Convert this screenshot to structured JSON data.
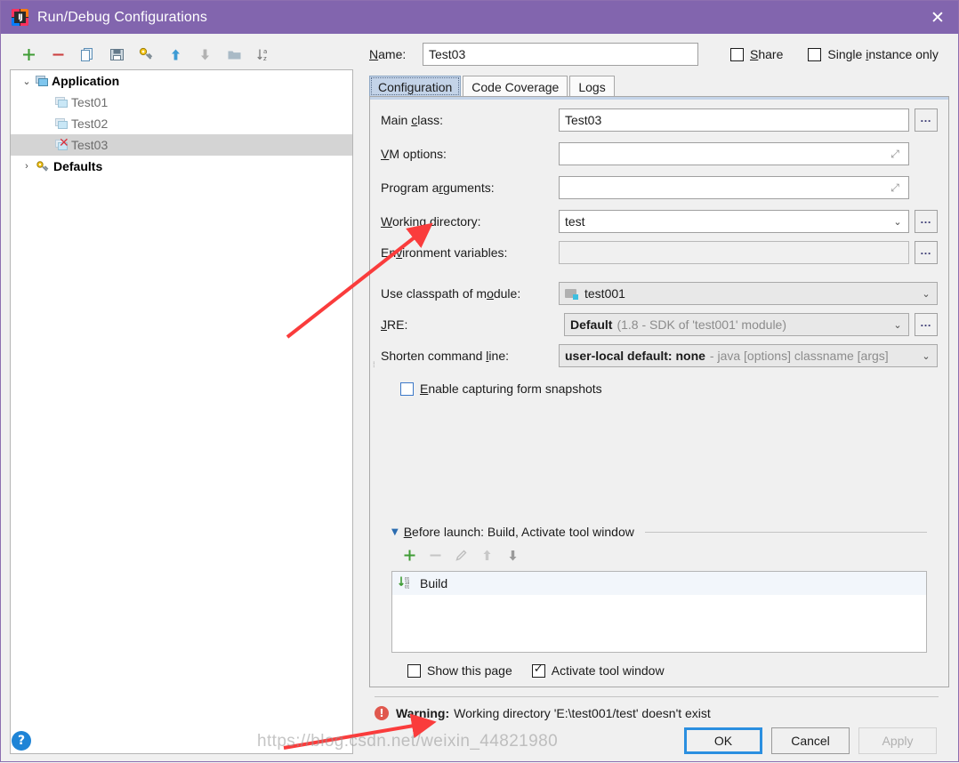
{
  "window": {
    "title": "Run/Debug Configurations",
    "logo_icon": "intellij-idea-logo",
    "close_icon": "close-icon",
    "titlebar_color": "#8265ae"
  },
  "toolbar": {
    "buttons": [
      {
        "name": "add",
        "icon": "plus-icon",
        "color": "#3f9c35"
      },
      {
        "name": "remove",
        "icon": "minus-icon",
        "color": "#cc4141"
      },
      {
        "name": "copy",
        "icon": "copy-icon",
        "color": "#6ca6cf"
      },
      {
        "name": "save",
        "icon": "save-icon",
        "color": "#6f8fa8"
      },
      {
        "name": "edit-templates",
        "icon": "wrench-icon",
        "color": "#d9a404"
      },
      {
        "name": "move-up",
        "icon": "arrow-up-icon",
        "color": "#3d9bd4"
      },
      {
        "name": "move-down",
        "icon": "arrow-down-icon",
        "color": "#a8a8a8"
      },
      {
        "name": "folder",
        "icon": "folder-icon",
        "color": "#9fb3c0"
      },
      {
        "name": "sort-alphabetically",
        "icon": "sort-az-icon",
        "color": "#7a7a7a"
      }
    ]
  },
  "tree": {
    "nodes": [
      {
        "label": "Application",
        "type": "group",
        "expanded": true,
        "twisty": "⌄",
        "icon": "application-icon"
      },
      {
        "label": "Test01",
        "type": "child",
        "icon": "application-icon",
        "error": false
      },
      {
        "label": "Test02",
        "type": "child",
        "icon": "application-icon",
        "error": false
      },
      {
        "label": "Test03",
        "type": "child",
        "icon": "application-icon",
        "error": true,
        "selected": true
      },
      {
        "label": "Defaults",
        "type": "group",
        "expanded": false,
        "twisty": "›",
        "icon": "wrench-icon"
      }
    ]
  },
  "header": {
    "name_label": "Name:",
    "name_label_mnemonic": "N",
    "name_value": "Test03",
    "share_label": "Share",
    "share_mnemonic": "S",
    "share_checked": false,
    "single_instance_label": "Single instance only",
    "single_instance_mnemonic": "i",
    "single_instance_checked": false
  },
  "tabs": [
    {
      "label": "Configuration",
      "active": true
    },
    {
      "label": "Code Coverage",
      "active": false
    },
    {
      "label": "Logs",
      "active": false
    }
  ],
  "form": {
    "main_class": {
      "label_pre": "Main ",
      "label_mn": "c",
      "label_post": "lass:",
      "value": "Test03",
      "browse": "...",
      "browse_icon": "ellipsis-icon"
    },
    "vm_options": {
      "label_pre": "",
      "label_mn": "V",
      "label_post": "M options:",
      "value": "",
      "expand_icon": "expand-icon"
    },
    "program_arguments": {
      "label_pre": "Program a",
      "label_mn": "r",
      "label_post": "guments:",
      "value": "",
      "expand_icon": "expand-icon"
    },
    "working_directory": {
      "label_pre": "",
      "label_mn": "W",
      "label_post": "orking directory:",
      "value": "test",
      "caret_icon": "chevron-down-icon",
      "browse": "...",
      "browse_icon": "ellipsis-icon"
    },
    "environment_variables": {
      "label_pre": "En",
      "label_mn": "v",
      "label_post": "ironment variables:",
      "value": "",
      "browse": "...",
      "browse_icon": "ellipsis-icon",
      "disabled": true
    },
    "classpath_module": {
      "label_pre": "Use classpath of m",
      "label_mn": "o",
      "label_post": "dule:",
      "value": "test001",
      "icon": "module-icon",
      "caret_icon": "chevron-down-icon"
    },
    "jre": {
      "label_pre": "",
      "label_mn": "J",
      "label_post": "RE:",
      "value_bold": "Default",
      "value_muted": "(1.8 - SDK of 'test001' module)",
      "caret_icon": "chevron-down-icon",
      "browse": "...",
      "browse_icon": "ellipsis-icon"
    },
    "shorten_command_line": {
      "label_pre": "Shorten command ",
      "label_mn": "l",
      "label_post": "ine:",
      "value_bold": "user-local default: none",
      "value_muted": "- java [options] classname [args]",
      "caret_icon": "chevron-down-icon"
    },
    "form_snapshots": {
      "label_pre": "",
      "label_mn": "E",
      "label_post": "nable capturing form snapshots",
      "checked": false
    }
  },
  "before_launch": {
    "triangle_icon": "triangle-down-icon",
    "header_pre": "",
    "header_mn": "B",
    "header_post": "efore launch: Build, Activate tool window",
    "toolbar": [
      {
        "name": "add-task",
        "icon": "plus-icon",
        "color": "#3f9c35",
        "enabled": true
      },
      {
        "name": "remove-task",
        "icon": "minus-icon",
        "color": "#bdbdbd",
        "enabled": false
      },
      {
        "name": "edit-task",
        "icon": "pencil-icon",
        "color": "#bdbdbd",
        "enabled": false
      },
      {
        "name": "move-task-up",
        "icon": "arrow-up-icon",
        "color": "#bdbdbd",
        "enabled": false
      },
      {
        "name": "move-task-down",
        "icon": "arrow-down-icon",
        "color": "#9a9a9a",
        "enabled": false
      }
    ],
    "items": [
      {
        "label": "Build",
        "icon": "build-icon"
      }
    ],
    "show_page_label": "Show this page",
    "show_page_checked": false,
    "activate_tool_window_label": "Activate tool window",
    "activate_tool_window_checked": true
  },
  "warning": {
    "icon": "warning-icon",
    "prefix": "Warning:",
    "message": "Working directory 'E:\\test001/test' doesn't exist",
    "icon_color": "#e0584e"
  },
  "footer": {
    "help_label": "?",
    "help_icon": "help-icon",
    "ok_label": "OK",
    "cancel_label": "Cancel",
    "apply_label": "Apply",
    "apply_disabled": true
  },
  "annotations": {
    "watermark": "https://blog.csdn.net/weixin_44821980",
    "arrow_color": "#fa3c3c",
    "arrows": [
      {
        "name": "arrow-to-working-directory"
      },
      {
        "name": "arrow-to-warning"
      }
    ]
  }
}
